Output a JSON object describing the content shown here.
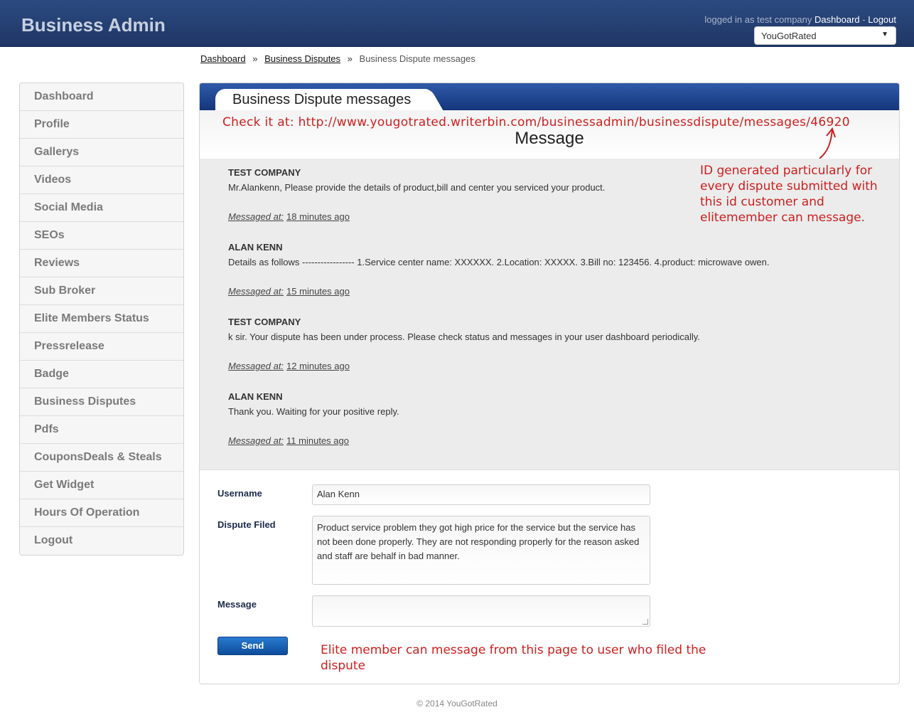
{
  "header": {
    "brand": "Business Admin",
    "logged_in_prefix": "logged in as test company",
    "dashboard_link": "Dashboard",
    "separator": "-",
    "logout_link": "Logout",
    "company_select_value": "YouGotRated"
  },
  "breadcrumb": {
    "items": [
      "Dashboard",
      "Business Disputes"
    ],
    "current": "Business Dispute messages",
    "separator": "»"
  },
  "sidebar": {
    "items": [
      {
        "label": "Dashboard"
      },
      {
        "label": "Profile"
      },
      {
        "label": "Gallerys"
      },
      {
        "label": "Videos"
      },
      {
        "label": "Social Media"
      },
      {
        "label": "SEOs"
      },
      {
        "label": "Reviews"
      },
      {
        "label": "Sub Broker"
      },
      {
        "label": "Elite Members Status"
      },
      {
        "label": "Pressrelease"
      },
      {
        "label": "Badge"
      },
      {
        "label": "Business Disputes"
      },
      {
        "label": "Pdfs"
      },
      {
        "label": "CouponsDeals & Steals"
      },
      {
        "label": "Get Widget"
      },
      {
        "label": "Hours Of Operation"
      },
      {
        "label": "Logout"
      }
    ]
  },
  "panel": {
    "title": "Business Dispute messages",
    "heading": "Message",
    "annotation_url": "Check it at: http://www.yougotrated.writerbin.com/businessadmin/businessdispute/messages/46920",
    "annotation_id": "ID generated particularly for every dispute submitted with this id customer and elitemember can message.",
    "annotation_send": "Elite member can message from this page to user who filed the dispute"
  },
  "messages": [
    {
      "author": "TEST COMPANY",
      "body": "Mr.Alankenn, Please provide the details of product,bill and center you serviced your product.",
      "meta_label": "Messaged at:",
      "time": "18 minutes ago"
    },
    {
      "author": "ALAN KENN",
      "body": "Details as follows ----------------- 1.Service center name: XXXXXX. 2.Location: XXXXX. 3.Bill no: 123456. 4.product: microwave owen.",
      "meta_label": "Messaged at:",
      "time": "15 minutes ago"
    },
    {
      "author": "TEST COMPANY",
      "body": "k sir. Your dispute has been under process. Please check status and messages in your user dashboard periodically.",
      "meta_label": "Messaged at:",
      "time": "12 minutes ago"
    },
    {
      "author": "ALAN KENN",
      "body": "Thank you. Waiting for your positive reply.",
      "meta_label": "Messaged at:",
      "time": "11 minutes ago"
    }
  ],
  "form": {
    "username_label": "Username",
    "username_value": "Alan Kenn",
    "dispute_label": "Dispute Filed",
    "dispute_value": "Product service problem they got high price for the service but the service has not been done properly. They are not responding properly for the reason asked and staff are behalf in bad manner.",
    "message_label": "Message",
    "message_value": "",
    "send_label": "Send"
  },
  "footer": {
    "text": "© 2014 YouGotRated"
  },
  "colors": {
    "header_bg": "#1f3767",
    "panel_head": "#14367c",
    "annotation": "#cc1f1f",
    "send_button": "#0d4c9a"
  }
}
